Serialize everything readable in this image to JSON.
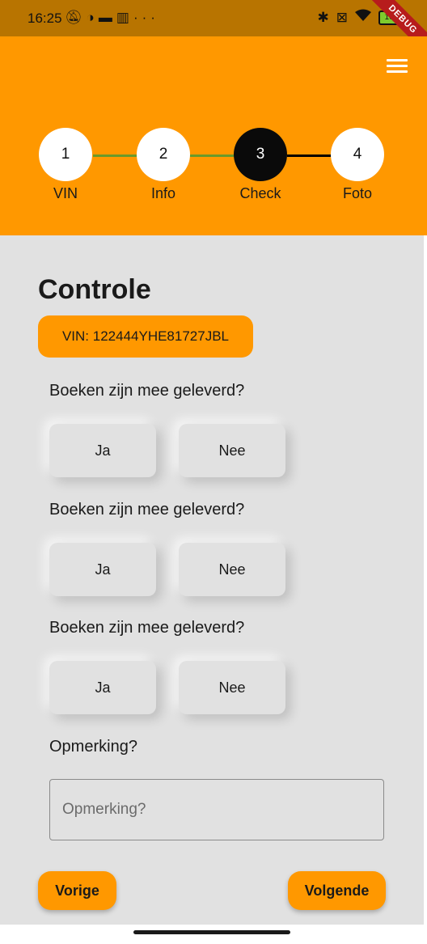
{
  "status_bar": {
    "time": "16:25",
    "left_icons": [
      "notifications-off-icon",
      "vpn-icon",
      "cast-icon",
      "trash-icon",
      "more-icon"
    ],
    "more_label": "···",
    "battery": "100",
    "debug_banner": "DEBUG"
  },
  "header": {
    "menu_icon": "hamburger-menu-icon",
    "steps": [
      {
        "number": "1",
        "label": "VIN",
        "state": "done"
      },
      {
        "number": "2",
        "label": "Info",
        "state": "done"
      },
      {
        "number": "3",
        "label": "Check",
        "state": "active"
      },
      {
        "number": "4",
        "label": "Foto",
        "state": "todo"
      }
    ],
    "colors": {
      "done_line": "#6a9a2a",
      "active_line": "#000000",
      "accent": "#ff9800",
      "active_circle": "#0a0a0a"
    }
  },
  "main": {
    "title": "Controle",
    "vin_chip": "VIN: 122444YHE81727JBL",
    "questions": [
      {
        "label": "Boeken zijn mee geleverd?",
        "yes": "Ja",
        "no": "Nee"
      },
      {
        "label": "Boeken zijn mee geleverd?",
        "yes": "Ja",
        "no": "Nee"
      },
      {
        "label": "Boeken zijn mee geleverd?",
        "yes": "Ja",
        "no": "Nee"
      }
    ],
    "remark": {
      "label": "Opmerking?",
      "placeholder": "Opmerking?",
      "value": ""
    },
    "prev_label": "Vorige",
    "next_label": "Volgende"
  }
}
